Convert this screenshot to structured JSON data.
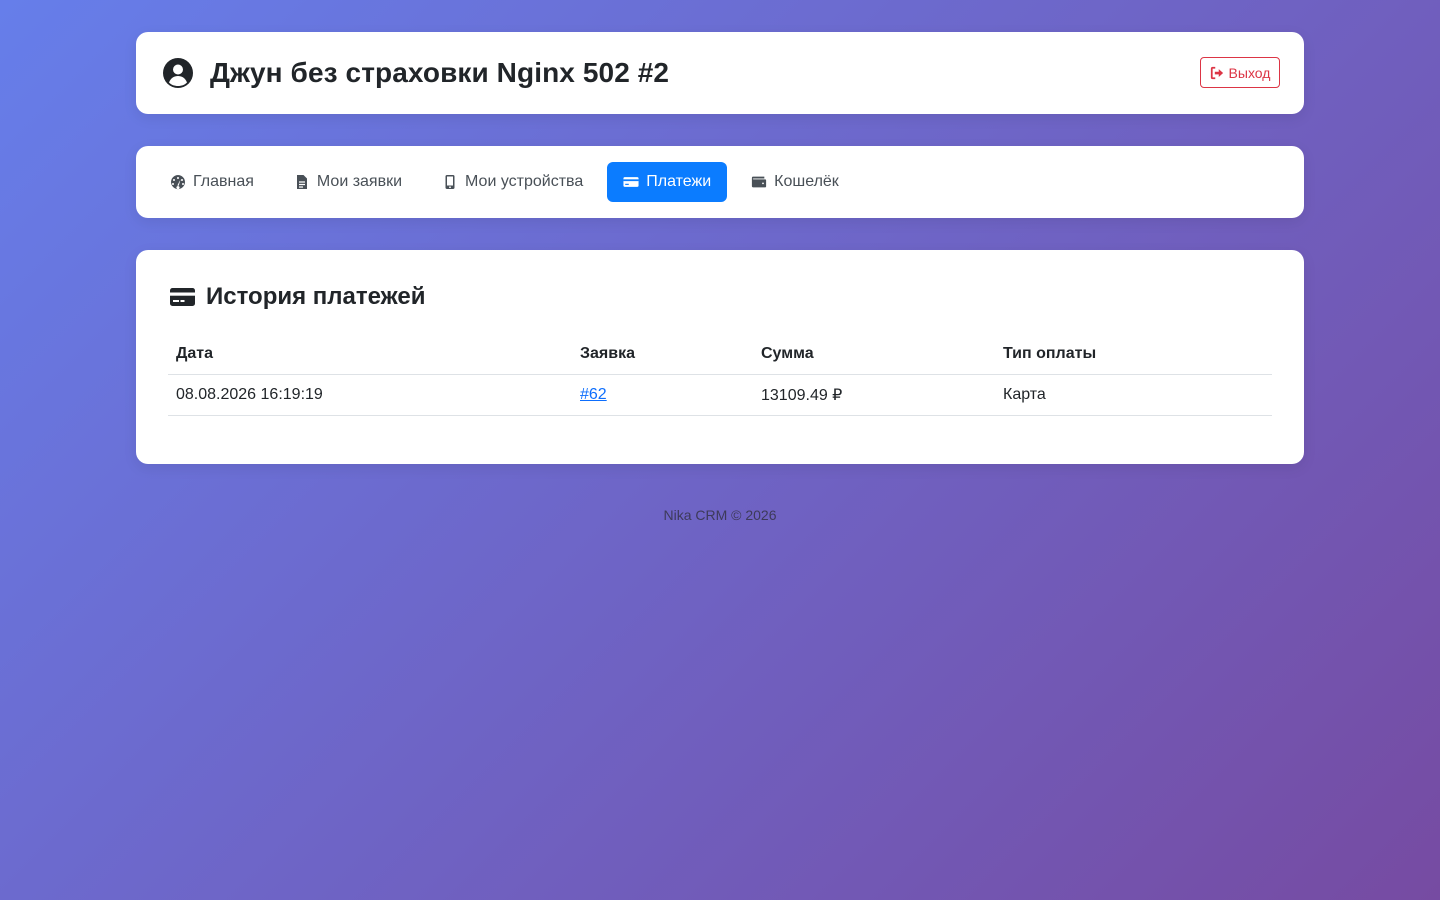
{
  "header": {
    "title": "Джун без страховки Nginx 502 #2",
    "logout_label": "Выход",
    "user_icon": "user-circle-icon"
  },
  "nav": {
    "items": [
      {
        "label": "Главная",
        "icon": "gauge-icon",
        "active": false
      },
      {
        "label": "Мои заявки",
        "icon": "file-icon",
        "active": false
      },
      {
        "label": "Мои устройства",
        "icon": "mobile-icon",
        "active": false
      },
      {
        "label": "Платежи",
        "icon": "credit-card-icon",
        "active": true
      },
      {
        "label": "Кошелёк",
        "icon": "wallet-icon",
        "active": false
      }
    ]
  },
  "payments": {
    "title": "История платежей",
    "columns": [
      "Дата",
      "Заявка",
      "Сумма",
      "Тип оплаты"
    ],
    "rows": [
      {
        "date": "08.08.2026 16:19:19",
        "order": "#62",
        "amount": "13109.49 ₽",
        "type": "Карта"
      }
    ]
  },
  "footer": {
    "text": "Nika CRM © 2026"
  },
  "colors": {
    "gradient_start": "#667eea",
    "gradient_end": "#764ba2",
    "active_nav": "#0b7cff",
    "logout": "#dc3545",
    "link": "#0d6efd"
  }
}
